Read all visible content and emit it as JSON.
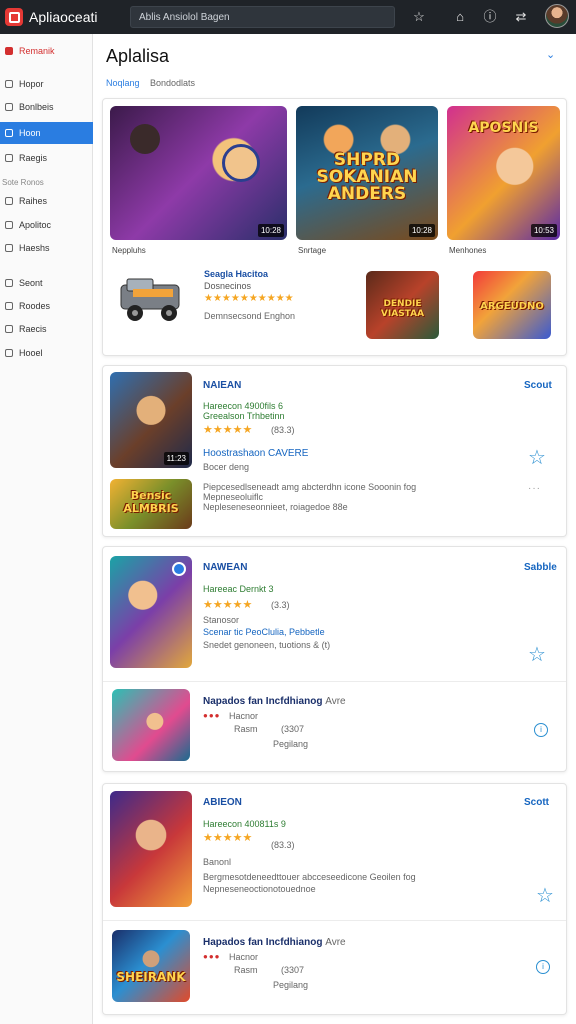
{
  "app": {
    "name": "Apliaoceati",
    "search_text": "Ablis Ansiolol Bagen"
  },
  "sidebar": {
    "items": [
      {
        "label": "Remanik"
      },
      {
        "label": "Hopor"
      },
      {
        "label": "Bonlbeis"
      },
      {
        "label": "Hoon"
      },
      {
        "label": "Raegis"
      },
      {
        "label": "Raihes"
      },
      {
        "label": "Apolitoc"
      },
      {
        "label": "Haeshs"
      },
      {
        "label": "Seont"
      },
      {
        "label": "Roodes"
      },
      {
        "label": "Raecis"
      },
      {
        "label": "Hooel"
      }
    ],
    "section_label": "Sote Ronos"
  },
  "main": {
    "title": "Aplalisa",
    "tabs": [
      "Noqlang",
      "Bondodlats"
    ]
  },
  "featured": {
    "banners": [
      {
        "badge": "10:28",
        "caption": "Neppluhs"
      },
      {
        "title_art": "SHPRD SOKANIAN ANDERS",
        "badge": "10:28",
        "caption": "Snrtage"
      },
      {
        "title_art": "APOSNIS",
        "badge": "10:53",
        "caption": "Menhones"
      }
    ],
    "promo": {
      "title": "Seagla Hacitoa",
      "subtitle": "Dosnecinos",
      "stars": "★★★★★★★★★★",
      "desc": "Demnsecsond Enghon"
    },
    "thumbs": [
      {
        "title_art": "DENDIE VIASTAA"
      },
      {
        "title_art": "ARGEUDNO"
      }
    ]
  },
  "list_cards": [
    {
      "items": [
        {
          "title": "NAIEAN",
          "right_label": "Scout",
          "badge": "11:23",
          "green_line": "Hareecon 4900fils 6",
          "green_sub": "Greealson Trhbetinn",
          "stars": "★★★★★",
          "rating_note": "(83.3)",
          "link_title": "Hoostrashaon CAVERE",
          "sub": "Bocer deng"
        },
        {
          "title_art": "Bensic ALMBRIS",
          "desc_1": "Piepcesedlseneadt amg abcterdhn icone Sooonin fog",
          "desc_2": "Mepneseoluiflc",
          "desc_3": "Nepleseneseonnieet, roiagedoe 88e",
          "menu": "···"
        }
      ]
    },
    {
      "items": [
        {
          "title": "NAWEAN",
          "right_label": "Sabble",
          "green_line": "Hareeac Dernkt 3",
          "stars": "★★★★★",
          "rating_note": "(3.3)",
          "sub": "Stanosor",
          "link_title": "Scenar tic PeoClulia, Pebbetle",
          "desc": "Snedet genoneen, tuotions & (t)"
        },
        {
          "title": "Napados fan Incfdhianog",
          "title_suffix": "Avre",
          "dots": "●●●",
          "sub": "Hacnor",
          "rating_label": "Rasm",
          "rating_note": "(3307",
          "extra": "Pegilang"
        }
      ]
    },
    {
      "items": [
        {
          "title": "ABIEON",
          "right_label": "Scott",
          "green_line": "Hareecon 400811s 9",
          "stars": "★★★★★",
          "rating_note": "(83.3)",
          "sub": "Banonl",
          "desc_1": "Bergmesotdeneedttouer abcceseedicone Geoilen fog",
          "desc_2": "Nepneseneoctionotouednoe"
        },
        {
          "title": "Hapados fan Incfdhianog",
          "title_suffix": "Avre",
          "dots": "●●●",
          "sub": "Hacnor",
          "rating_label": "Rasm",
          "rating_note": "(3307",
          "extra": "Pegilang",
          "title_art": "SHEIRANK"
        }
      ]
    }
  ]
}
